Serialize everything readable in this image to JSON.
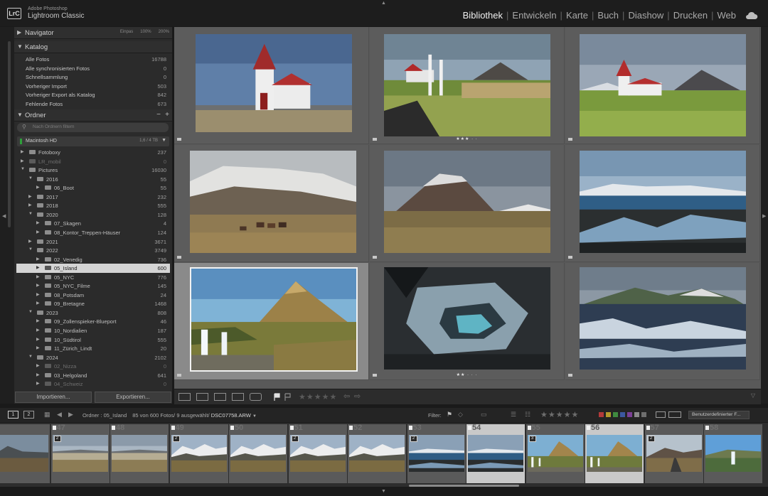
{
  "app": {
    "logo": "LrC",
    "vendor": "Adobe Photoshop",
    "name": "Lightroom Classic"
  },
  "modules": [
    "Bibliothek",
    "Entwickeln",
    "Karte",
    "Buch",
    "Diashow",
    "Drucken",
    "Web"
  ],
  "active_module": "Bibliothek",
  "navigator": {
    "title": "Navigator",
    "zoom": [
      "Einpas",
      "100%",
      "200%"
    ]
  },
  "catalog": {
    "title": "Katalog",
    "items": [
      {
        "label": "Alle Fotos",
        "count": "16788"
      },
      {
        "label": "Alle synchronisierten Fotos",
        "count": "0"
      },
      {
        "label": "Schnellsammlung",
        "count": "0"
      },
      {
        "label": "Vorheriger Import",
        "count": "503"
      },
      {
        "label": "Vorheriger Export als Katalog",
        "count": "842"
      },
      {
        "label": "Fehlende Fotos",
        "count": "673"
      }
    ]
  },
  "folders": {
    "title": "Ordner",
    "search_placeholder": "Nach Ordnern filtern",
    "volume": {
      "name": "Macintosh HD",
      "size": "1,6 / 4 TB"
    },
    "items": [
      {
        "name": "Fotoboxy",
        "count": "237",
        "depth": 0,
        "expanded": false
      },
      {
        "name": "LR_mobil",
        "count": "0",
        "depth": 0,
        "expanded": false,
        "dim": true
      },
      {
        "name": "Pictures",
        "count": "16030",
        "depth": 0,
        "expanded": true
      },
      {
        "name": "2016",
        "count": "55",
        "depth": 1,
        "expanded": true
      },
      {
        "name": "06_Boot",
        "count": "55",
        "depth": 2,
        "expanded": false
      },
      {
        "name": "2017",
        "count": "232",
        "depth": 1,
        "expanded": false
      },
      {
        "name": "2018",
        "count": "555",
        "depth": 1,
        "expanded": false
      },
      {
        "name": "2020",
        "count": "128",
        "depth": 1,
        "expanded": true
      },
      {
        "name": "07_Skagen",
        "count": "4",
        "depth": 2,
        "expanded": false
      },
      {
        "name": "08_Kontor_Treppen-Häuser",
        "count": "124",
        "depth": 2,
        "expanded": false
      },
      {
        "name": "2021",
        "count": "3671",
        "depth": 1,
        "expanded": false
      },
      {
        "name": "2022",
        "count": "3749",
        "depth": 1,
        "expanded": true
      },
      {
        "name": "02_Venedig",
        "count": "736",
        "depth": 2,
        "expanded": false
      },
      {
        "name": "05_Island",
        "count": "600",
        "depth": 2,
        "expanded": false,
        "selected": true
      },
      {
        "name": "05_NYC",
        "count": "776",
        "depth": 2,
        "expanded": false
      },
      {
        "name": "05_NYC_Filme",
        "count": "145",
        "depth": 2,
        "expanded": false
      },
      {
        "name": "08_Potsdam",
        "count": "24",
        "depth": 2,
        "expanded": false
      },
      {
        "name": "09_Bretagne",
        "count": "1468",
        "depth": 2,
        "expanded": false
      },
      {
        "name": "2023",
        "count": "808",
        "depth": 1,
        "expanded": true
      },
      {
        "name": "09_Zollenspieker-Blueport",
        "count": "46",
        "depth": 2,
        "expanded": false
      },
      {
        "name": "10_Nordialien",
        "count": "187",
        "depth": 2,
        "expanded": false
      },
      {
        "name": "10_Südtirol",
        "count": "555",
        "depth": 2,
        "expanded": false
      },
      {
        "name": "11_Zürich_Lindt",
        "count": "20",
        "depth": 2,
        "expanded": false
      },
      {
        "name": "2024",
        "count": "2102",
        "depth": 1,
        "expanded": true
      },
      {
        "name": "02_Nizza",
        "count": "0",
        "depth": 2,
        "expanded": false,
        "dim": true
      },
      {
        "name": "03_Helgoland",
        "count": "641",
        "depth": 2,
        "expanded": false
      },
      {
        "name": "04_Schweiz",
        "count": "0",
        "depth": 2,
        "expanded": false,
        "dim": true
      }
    ]
  },
  "buttons": {
    "import": "Importieren...",
    "export": "Exportieren..."
  },
  "grid": {
    "cells": [
      {
        "scene": "church-blue",
        "stars": ""
      },
      {
        "scene": "church-fence",
        "stars": "★★★ · ·"
      },
      {
        "scene": "church-green",
        "stars": ""
      },
      {
        "scene": "horses",
        "stars": ""
      },
      {
        "scene": "kirkjufell-plain",
        "stars": ""
      },
      {
        "scene": "coast",
        "stars": ""
      },
      {
        "scene": "waterfall",
        "stars": "",
        "selected": true
      },
      {
        "scene": "ice-cave",
        "stars": "★★ · · ·"
      },
      {
        "scene": "river-delta",
        "stars": ""
      }
    ]
  },
  "toolbar": {
    "rating_stars": "★★★★★"
  },
  "filmbar": {
    "monitor_buttons": [
      "1",
      "2"
    ],
    "source": "Ordner : 05_Island",
    "counts": "85 von 600 Fotos/ 9 ausgewählt/",
    "filename": "DSC07758.ARW",
    "filter_label": "Filter:",
    "filter_stars": "★★★★★",
    "custom_filter": "Benutzerdefinierter F...",
    "swatches": [
      "#b23a3a",
      "#b59a2c",
      "#3f8a3f",
      "#3c58a0",
      "#7b3f95",
      "#8a8a8a",
      "#6e6e6e"
    ]
  },
  "filmstrip": [
    {
      "num": "",
      "scene": "mountain-dark",
      "stack": ""
    },
    {
      "num": "47",
      "scene": "beach-wide",
      "stack": "2"
    },
    {
      "num": "48",
      "scene": "beach-wide",
      "stack": ""
    },
    {
      "num": "49",
      "scene": "snow-mountains",
      "stack": "2"
    },
    {
      "num": "50",
      "scene": "snow-mountains",
      "stack": ""
    },
    {
      "num": "51",
      "scene": "snow-mountains",
      "stack": "2"
    },
    {
      "num": "52",
      "scene": "snow-mountains",
      "stack": ""
    },
    {
      "num": "53",
      "scene": "coast-dark",
      "stack": "2"
    },
    {
      "num": "54",
      "scene": "coast-dark",
      "stack": "",
      "selected": true
    },
    {
      "num": "55",
      "scene": "kirkjufell-waterfall",
      "stack": "3"
    },
    {
      "num": "56",
      "scene": "kirkjufell-waterfall",
      "stack": "",
      "selected": true
    },
    {
      "num": "57",
      "scene": "road-mountain",
      "stack": "2"
    },
    {
      "num": "58",
      "scene": "waterfall-blue",
      "stack": ""
    }
  ]
}
